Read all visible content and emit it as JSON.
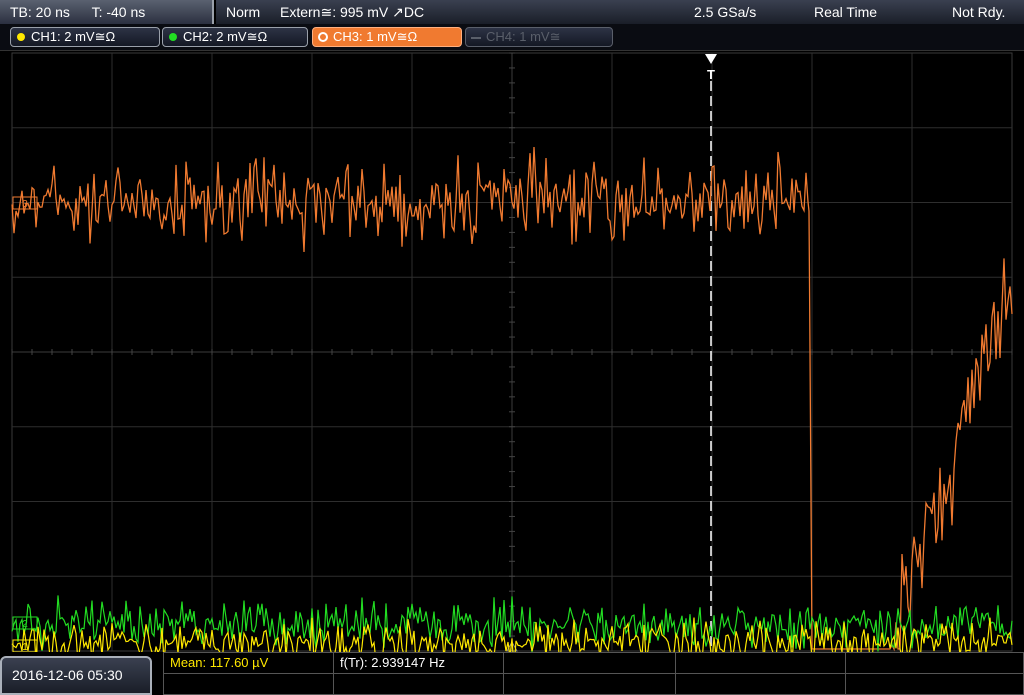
{
  "topbar": {
    "timebase": "TB: 20 ns",
    "trigger_pos": "T: -40 ns",
    "mode": "Norm",
    "trigger_source": "Extern≅: 995 mV ↗DC",
    "sample_rate": "2.5 GSa/s",
    "acq_mode": "Real Time",
    "status": "Not Rdy."
  },
  "channels": [
    {
      "label": "CH1: 2 mV≅Ω",
      "color": "#ffe800",
      "state": "on"
    },
    {
      "label": "CH2: 2 mV≅Ω",
      "color": "#22dd22",
      "state": "on"
    },
    {
      "label": "CH3: 1 mV≅Ω",
      "color": "#f07a30",
      "state": "active"
    },
    {
      "label": "CH4: 1 mV≅",
      "color": "#5a5f6a",
      "state": "off"
    }
  ],
  "markers": {
    "trigger_label": "T",
    "ch3_marker": "3",
    "ch2_marker": "2",
    "ch1_marker": "1"
  },
  "chart_data": {
    "type": "line",
    "title": "",
    "xlabel": "",
    "ylabel": "",
    "grid": true,
    "series": [
      {
        "name": "CH3",
        "color": "#f07a30",
        "baseline_div": 1.0,
        "description_values": [
          1.0
        ]
      },
      {
        "name": "CH2",
        "color": "#22dd22"
      },
      {
        "name": "CH1",
        "color": "#ffe800"
      }
    ]
  },
  "bottombar": {
    "datetime": "2016-12-06 05:30",
    "mean": "Mean: 117.60 µV",
    "frequency": "f(Tr): 2.939147 Hz"
  }
}
